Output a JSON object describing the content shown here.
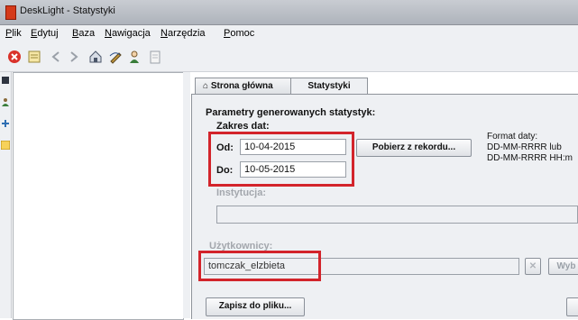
{
  "window": {
    "title": "DeskLight - Statystyki"
  },
  "menu": [
    {
      "pre": "",
      "u": "P",
      "post": "lik"
    },
    {
      "pre": "",
      "u": "E",
      "post": "dytuj"
    },
    {
      "pre": "",
      "u": "B",
      "post": "aza"
    },
    {
      "pre": "",
      "u": "N",
      "post": "awigacja"
    },
    {
      "pre": "",
      "u": "N",
      "post": "arzędzia"
    },
    {
      "pre": "",
      "u": "P",
      "post": "omoc"
    }
  ],
  "tabs": {
    "home": "Strona główna",
    "stats": "Statystyki"
  },
  "form": {
    "section_title": "Parametry generowanych statystyk:",
    "date_range_title": "Zakres dat:",
    "from_label": "Od:",
    "from_value": "10-04-2015",
    "to_label": "Do:",
    "to_value": "10-05-2015",
    "fetch_button": "Pobierz z rekordu...",
    "format_title": "Format daty:",
    "format_line1": "DD-MM-RRRR lub",
    "format_line2": "DD-MM-RRRR HH:m",
    "institution_label": "Instytucja:",
    "institution_value": "",
    "users_label": "Użytkownicy:",
    "users_value": "tomczak_elzbieta",
    "choose_button": "Wyb",
    "save_button": "Zapisz do pliku..."
  },
  "colors": {
    "highlight": "#d3242b",
    "accent_red": "#d43a1a",
    "tab_border": "#8e939a"
  },
  "icons": [
    "close-circle-icon",
    "note-icon",
    "back-arrow-icon",
    "forward-arrow-icon",
    "home-icon",
    "edit-icon",
    "user-icon",
    "document-icon"
  ]
}
